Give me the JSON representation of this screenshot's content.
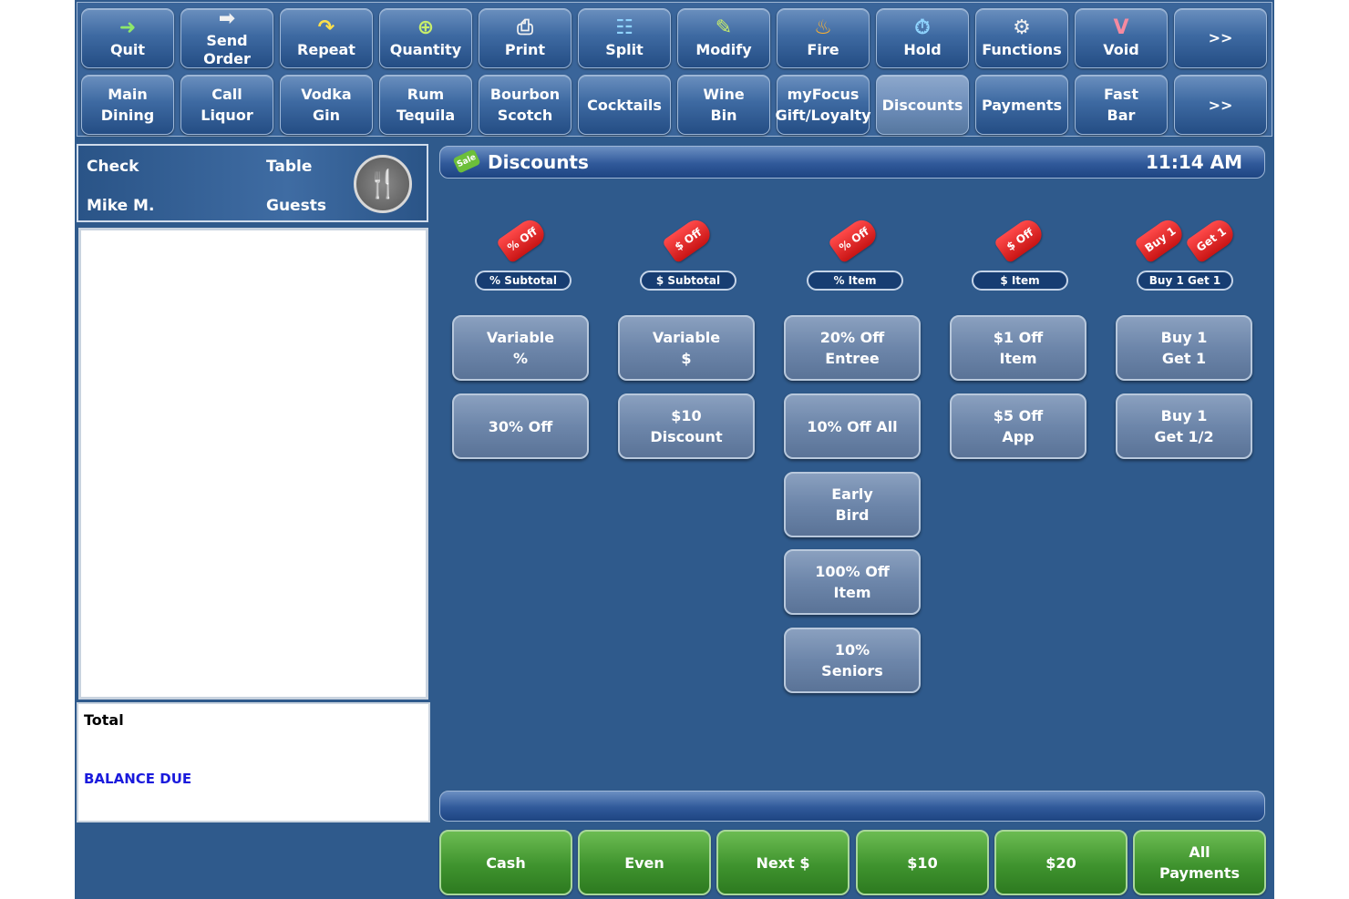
{
  "toolbar": {
    "row1": [
      {
        "label": "Quit",
        "icon": "exit-door-icon"
      },
      {
        "label": "Send Order",
        "icon": "arrow-right-icon"
      },
      {
        "label": "Repeat",
        "icon": "repeat-arrow-icon"
      },
      {
        "label": "Quantity",
        "icon": "plus-circle-icon"
      },
      {
        "label": "Print",
        "icon": "printer-icon"
      },
      {
        "label": "Split",
        "icon": "list-split-icon"
      },
      {
        "label": "Modify",
        "icon": "pencil-icon"
      },
      {
        "label": "Fire",
        "icon": "flame-icon"
      },
      {
        "label": "Hold",
        "icon": "stopwatch-icon"
      },
      {
        "label": "Functions",
        "icon": "gear-icon"
      },
      {
        "label": "Void",
        "icon": "void-v-icon"
      },
      {
        "label": ">>",
        "icon": ""
      }
    ],
    "row2": [
      {
        "label": "Main\nDining"
      },
      {
        "label": "Call\nLiquor"
      },
      {
        "label": "Vodka\nGin"
      },
      {
        "label": "Rum\nTequila"
      },
      {
        "label": "Bourbon\nScotch"
      },
      {
        "label": "Cocktails"
      },
      {
        "label": "Wine\nBin"
      },
      {
        "label": "myFocus\nGift/Loyalty"
      },
      {
        "label": "Discounts"
      },
      {
        "label": "Payments"
      },
      {
        "label": "Fast\nBar"
      },
      {
        "label": ">>"
      }
    ]
  },
  "check": {
    "check_label": "Check",
    "table_label": "Table",
    "server": "Mike M.",
    "guests_label": "Guests",
    "total_label": "Total",
    "balance_label": "BALANCE DUE"
  },
  "discounts": {
    "sale_badge": "Sale",
    "title": "Discounts",
    "time": "11:14 AM",
    "columns": [
      {
        "tags": [
          "% Off"
        ],
        "category": "% Subtotal",
        "buttons": [
          "Variable\n%",
          "30% Off"
        ]
      },
      {
        "tags": [
          "$ Off"
        ],
        "category": "$ Subtotal",
        "buttons": [
          "Variable\n$",
          "$10\nDiscount"
        ]
      },
      {
        "tags": [
          "% Off"
        ],
        "category": "% Item",
        "buttons": [
          "20% Off\nEntree",
          "10% Off All",
          "Early\nBird",
          "100% Off\nItem",
          "10%\nSeniors"
        ]
      },
      {
        "tags": [
          "$ Off"
        ],
        "category": "$ Item",
        "buttons": [
          "$1 Off\nItem",
          "$5 Off\nApp"
        ]
      },
      {
        "tags": [
          "Buy 1",
          "Get 1"
        ],
        "category": "Buy 1 Get 1",
        "buttons": [
          "Buy 1\nGet 1",
          "Buy 1\nGet 1/2"
        ]
      }
    ]
  },
  "payments": [
    "Cash",
    "Even",
    "Next $",
    "$10",
    "$20",
    "All\nPayments"
  ]
}
